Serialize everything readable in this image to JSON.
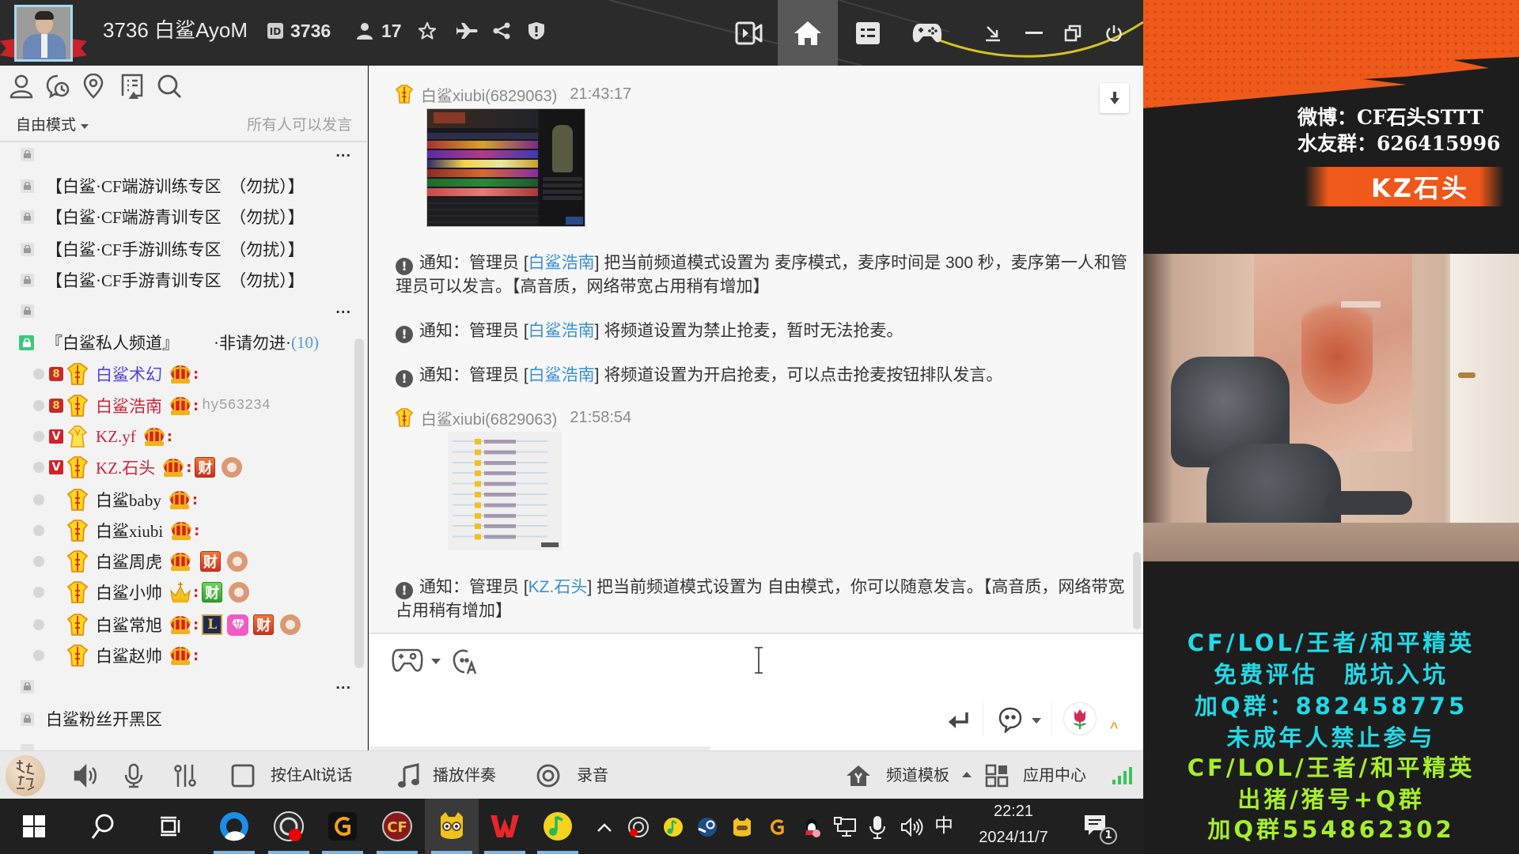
{
  "window": {
    "title": "3736 白鲨AyoM",
    "channel_id": "3736",
    "online_count": "17",
    "header_icons": [
      "id-icon",
      "user-icon",
      "star-icon",
      "plane-icon",
      "share-icon",
      "shield-alert-icon"
    ],
    "nav_icons": [
      "video-record-icon",
      "home-icon",
      "list-icon",
      "gamepad-icon",
      "minimize-to-tray-icon",
      "minimize-icon",
      "restore-icon",
      "power-icon"
    ],
    "active_nav": "home"
  },
  "sidebar": {
    "toolbar_icons": [
      "user-icon",
      "chat-history-icon",
      "location-icon",
      "announcement-icon",
      "search-icon"
    ],
    "mode": {
      "label": "自由模式",
      "description": "所有人可以发言"
    },
    "more_label": "...",
    "channels": [
      {
        "name": "",
        "locked": true,
        "has_more": true
      },
      {
        "name": "【白鲨·CF端游训练专区　（勿扰）】",
        "locked": true
      },
      {
        "name": "【白鲨·CF端游青训专区　（勿扰）】",
        "locked": true
      },
      {
        "name": "【白鲨·CF手游训练专区　（勿扰）】",
        "locked": true
      },
      {
        "name": "【白鲨·CF手游青训专区　（勿扰）】",
        "locked": true
      },
      {
        "name": "",
        "locked": true,
        "has_more": true
      }
    ],
    "private_channel": {
      "name": "『白鲨私人频道』",
      "tag": "·非请勿进·",
      "count": "(10)",
      "lock_color": "#3fc57e"
    },
    "members": [
      {
        "name": "白鲨术幻",
        "color": "#5a3fd9",
        "icons": [
          "rank-badge",
          "vest",
          "crown"
        ],
        "separator": ":"
      },
      {
        "name": "白鲨浩南",
        "color": "#c8283c",
        "icons": [
          "rank-badge",
          "vest",
          "crown"
        ],
        "separator": ":",
        "signature": "hy563234"
      },
      {
        "name": "KZ.yf",
        "color": "#c8283c",
        "icons": [
          "vip-badge",
          "vest",
          "crown"
        ],
        "separator": ":"
      },
      {
        "name": "KZ.石头",
        "color": "#c8283c",
        "icons": [
          "vip-badge",
          "vest",
          "crown",
          "wealth-badge-red",
          "donut-badge"
        ],
        "separator": ":"
      },
      {
        "name": "白鲨baby",
        "color": "#222222",
        "icons": [
          "vest",
          "crown"
        ],
        "separator": ":"
      },
      {
        "name": "白鲨xiubi",
        "color": "#222222",
        "icons": [
          "vest",
          "crown"
        ],
        "separator": ":"
      },
      {
        "name": "白鲨周虎",
        "color": "#222222",
        "icons": [
          "vest",
          "crown",
          "wealth-badge-red",
          "donut-badge"
        ]
      },
      {
        "name": "白鲨小帅",
        "color": "#222222",
        "icons": [
          "vest",
          "small-crown",
          "wealth-badge-green",
          "donut-badge"
        ],
        "separator": ":"
      },
      {
        "name": "白鲨常旭",
        "color": "#222222",
        "icons": [
          "vest",
          "crown",
          "lol-badge",
          "gem-badge",
          "wealth-badge-red",
          "donut-badge"
        ],
        "separator": ":"
      },
      {
        "name": "白鲨赵帅",
        "color": "#222222",
        "icons": [
          "vest",
          "crown"
        ],
        "separator": ":"
      }
    ],
    "channels_after": [
      {
        "name": "",
        "locked": true,
        "has_more": true
      },
      {
        "name": "白鲨粉丝开黑区",
        "locked": true
      },
      {
        "name": "",
        "locked": true
      }
    ],
    "wealth_label": "财",
    "lol_label": "L",
    "rank_label": "8",
    "vip_label": "V"
  },
  "chat": {
    "notice_icon": "!",
    "messages": [
      {
        "type": "user",
        "sender": "白鲨xiubi(6829063)",
        "time": "21:43:17",
        "attachment": "game-screenshot-image"
      },
      {
        "type": "notice",
        "prefix": "通知：管理员 [",
        "admin": "白鲨浩南",
        "body": "] 把当前频道模式设置为 麦序模式，麦序时间是 300 秒，麦序第一人和管理员可以发言。【高音质，网络带宽占用稍有增加】"
      },
      {
        "type": "notice",
        "prefix": "通知：管理员 [",
        "admin": "白鲨浩南",
        "body": "] 将频道设置为禁止抢麦，暂时无法抢麦。"
      },
      {
        "type": "notice",
        "prefix": "通知：管理员 [",
        "admin": "白鲨浩南",
        "body": "] 将频道设置为开启抢麦，可以点击抢麦按钮排队发言。"
      },
      {
        "type": "user",
        "sender": "白鲨xiubi(6829063)",
        "time": "21:58:54",
        "attachment": "member-list-screenshot-image"
      },
      {
        "type": "notice",
        "prefix": "通知：管理员 [",
        "admin": "KZ.石头",
        "body": "] 把当前频道模式设置为 自由模式，你可以随意发言。【高音质，网络带宽占用稍有增加】"
      }
    ],
    "link_color": "#3a8fd6"
  },
  "input": {
    "value": "",
    "left_icons": [
      "game-icon",
      "ai-voice-icon"
    ],
    "right_icons": [
      "enter-send-icon",
      "chat-bubble-icon",
      "flower-gift-icon",
      "expand-icon"
    ]
  },
  "toolbar": {
    "push_to_talk_label": "按住Alt说话",
    "accompaniment_label": "播放伴奏",
    "record_label": "录音",
    "template_label": "频道模板",
    "app_center_label": "应用中心",
    "signal_color": "#3cc45a"
  },
  "taskbar": {
    "pinned_apps": [
      "browser",
      "obs-studio",
      "game-booster",
      "crossfire",
      "yy-voice",
      "wps-office",
      "qq-music"
    ],
    "active_app": "yy-voice",
    "tray_icons": [
      "obs-studio",
      "qq-music",
      "steam",
      "yy-voice",
      "game-booster",
      "qq"
    ],
    "ime": "中",
    "time": "22:21",
    "date": "2024/11/7",
    "notification_count": "1"
  },
  "overlay": {
    "weibo": "微博：CF石头STTT",
    "fan_group": "水友群：626415996",
    "banner": "KZ石头",
    "accent_color": "#f05a1a",
    "promo_lines": [
      {
        "text": "CF/LOL/王者/和平精英",
        "color": "#22d8e6"
      },
      {
        "text": "免费评估　脱坑入坑",
        "color": "#22d8e6"
      },
      {
        "text": "加Q群：882458775",
        "color": "#22d8e6"
      },
      {
        "text": "未成年人禁止参与",
        "color": "#22d8e6"
      },
      {
        "text": "CF/LOL/王者/和平精英",
        "color": "#a6ee2a"
      },
      {
        "text": "出猪/猪号+Q群",
        "color": "#a6ee2a"
      },
      {
        "text": "加Q群554862302",
        "color": "#a6ee2a"
      }
    ]
  }
}
